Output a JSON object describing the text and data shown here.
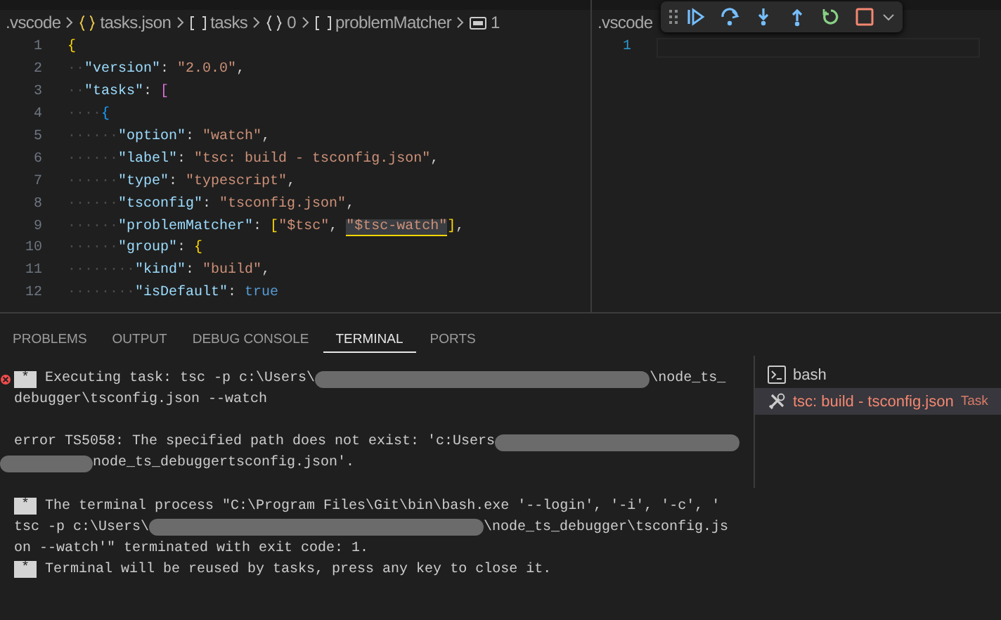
{
  "editor_left": {
    "breadcrumbs": [
      {
        "kind": "folder",
        "text": ".vscode"
      },
      {
        "kind": "json",
        "text": "tasks.json"
      },
      {
        "kind": "array",
        "text": "tasks"
      },
      {
        "kind": "object",
        "text": "0"
      },
      {
        "kind": "array",
        "text": "problemMatcher"
      },
      {
        "kind": "string",
        "text": "1"
      }
    ],
    "lines": [
      {
        "number": "1",
        "tokens": [
          {
            "kind": "brace1",
            "text": "{"
          }
        ]
      },
      {
        "number": "2",
        "tokens": [
          {
            "kind": "space",
            "text": "··"
          },
          {
            "kind": "key",
            "text": "\"version\""
          },
          {
            "kind": "plain",
            "text": ": "
          },
          {
            "kind": "string",
            "text": "\"2.0.0\""
          },
          {
            "kind": "plain",
            "text": ","
          }
        ]
      },
      {
        "number": "3",
        "tokens": [
          {
            "kind": "space",
            "text": "··"
          },
          {
            "kind": "key",
            "text": "\"tasks\""
          },
          {
            "kind": "plain",
            "text": ": "
          },
          {
            "kind": "brace2",
            "text": "["
          }
        ]
      },
      {
        "number": "4",
        "tokens": [
          {
            "kind": "space",
            "text": "····"
          },
          {
            "kind": "brace3",
            "text": "{"
          }
        ]
      },
      {
        "number": "5",
        "tokens": [
          {
            "kind": "space",
            "text": "······"
          },
          {
            "kind": "key",
            "text": "\"option\""
          },
          {
            "kind": "plain",
            "text": ": "
          },
          {
            "kind": "string",
            "text": "\"watch\""
          },
          {
            "kind": "plain",
            "text": ","
          }
        ]
      },
      {
        "number": "6",
        "tokens": [
          {
            "kind": "space",
            "text": "······"
          },
          {
            "kind": "key",
            "text": "\"label\""
          },
          {
            "kind": "plain",
            "text": ": "
          },
          {
            "kind": "string",
            "text": "\"tsc: build - tsconfig.json\""
          },
          {
            "kind": "plain",
            "text": ","
          }
        ]
      },
      {
        "number": "7",
        "tokens": [
          {
            "kind": "space",
            "text": "······"
          },
          {
            "kind": "key",
            "text": "\"type\""
          },
          {
            "kind": "plain",
            "text": ": "
          },
          {
            "kind": "string",
            "text": "\"typescript\""
          },
          {
            "kind": "plain",
            "text": ","
          }
        ]
      },
      {
        "number": "8",
        "tokens": [
          {
            "kind": "space",
            "text": "······"
          },
          {
            "kind": "key",
            "text": "\"tsconfig\""
          },
          {
            "kind": "plain",
            "text": ": "
          },
          {
            "kind": "string",
            "text": "\"tsconfig.json\""
          },
          {
            "kind": "plain",
            "text": ","
          }
        ]
      },
      {
        "number": "9",
        "tokens": [
          {
            "kind": "space",
            "text": "······"
          },
          {
            "kind": "key",
            "text": "\"problemMatcher\""
          },
          {
            "kind": "plain",
            "text": ": "
          },
          {
            "kind": "brace1",
            "text": "["
          },
          {
            "kind": "string",
            "text": "\"$tsc\""
          },
          {
            "kind": "plain",
            "text": ", "
          },
          {
            "kind": "highlighted",
            "text": "\"$tsc-watch\""
          },
          {
            "kind": "brace1",
            "text": "]"
          },
          {
            "kind": "plain",
            "text": ","
          }
        ]
      },
      {
        "number": "10",
        "tokens": [
          {
            "kind": "space",
            "text": "······"
          },
          {
            "kind": "key",
            "text": "\"group\""
          },
          {
            "kind": "plain",
            "text": ": "
          },
          {
            "kind": "brace1",
            "text": "{"
          }
        ]
      },
      {
        "number": "11",
        "tokens": [
          {
            "kind": "space",
            "text": "········"
          },
          {
            "kind": "key",
            "text": "\"kind\""
          },
          {
            "kind": "plain",
            "text": ": "
          },
          {
            "kind": "string",
            "text": "\"build\""
          },
          {
            "kind": "plain",
            "text": ","
          }
        ]
      },
      {
        "number": "12",
        "tokens": [
          {
            "kind": "space",
            "text": "········"
          },
          {
            "kind": "key",
            "text": "\"isDefault\""
          },
          {
            "kind": "plain",
            "text": ": "
          },
          {
            "kind": "bool",
            "text": "true"
          }
        ]
      }
    ]
  },
  "editor_right": {
    "breadcrumb": ".vscode",
    "lines": [
      {
        "number": "1"
      }
    ]
  },
  "debug_toolbar": {
    "buttons": [
      {
        "kind": "continue"
      },
      {
        "kind": "step-over"
      },
      {
        "kind": "step-into"
      },
      {
        "kind": "step-out"
      },
      {
        "kind": "restart"
      },
      {
        "kind": "stop"
      }
    ]
  },
  "panel": {
    "tabs": [
      {
        "label": "PROBLEMS",
        "selected": false
      },
      {
        "label": "OUTPUT",
        "selected": false
      },
      {
        "label": "DEBUG CONSOLE",
        "selected": false
      },
      {
        "label": "TERMINAL",
        "selected": true
      },
      {
        "label": "PORTS",
        "selected": false
      }
    ],
    "terminal_lines": [
      {
        "error": true,
        "parts": [
          {
            "kind": "marker",
            "text": "*"
          },
          {
            "kind": "text",
            "text": " Executing task: tsc -p c:\\Users\\"
          },
          {
            "kind": "redacted"
          },
          {
            "kind": "text",
            "text": "\\node_ts_"
          }
        ]
      },
      {
        "error": false,
        "parts": [
          {
            "kind": "text",
            "text": "debugger\\tsconfig.json --watch"
          }
        ]
      },
      {
        "error": false
      },
      {
        "error": false,
        "parts": [
          {
            "kind": "text",
            "text": "error TS5058: The specified path does not exist: 'c:Users"
          },
          {
            "kind": "redacted"
          }
        ]
      },
      {
        "error": false,
        "parts": [
          {
            "kind": "redacted"
          },
          {
            "kind": "text",
            "text": "node_ts_debuggertsconfig.json'."
          }
        ]
      },
      {
        "error": false
      },
      {
        "error": false,
        "parts": [
          {
            "kind": "marker",
            "text": "*"
          },
          {
            "kind": "text",
            "text": " The terminal process \"C:\\Program Files\\Git\\bin\\bash.exe '--login', '-i', '-c', '"
          }
        ]
      },
      {
        "error": false,
        "parts": [
          {
            "kind": "text",
            "text": "tsc -p c:\\Users\\"
          },
          {
            "kind": "redacted"
          },
          {
            "kind": "text",
            "text": "\\node_ts_debugger\\tsconfig.js"
          }
        ]
      },
      {
        "error": false,
        "parts": [
          {
            "kind": "text",
            "text": "on --watch'\" terminated with exit code: 1."
          }
        ]
      },
      {
        "error": false,
        "parts": [
          {
            "kind": "marker",
            "text": "*"
          },
          {
            "kind": "text",
            "text": " Terminal will be reused by tasks, press any key to close it."
          }
        ]
      }
    ],
    "terminal_list": [
      {
        "kind": "shell",
        "label": "bash",
        "selected": false,
        "failed": false
      },
      {
        "kind": "task",
        "label": "tsc: build - tsconfig.json",
        "tag": "Task",
        "selected": true,
        "failed": true
      }
    ]
  }
}
